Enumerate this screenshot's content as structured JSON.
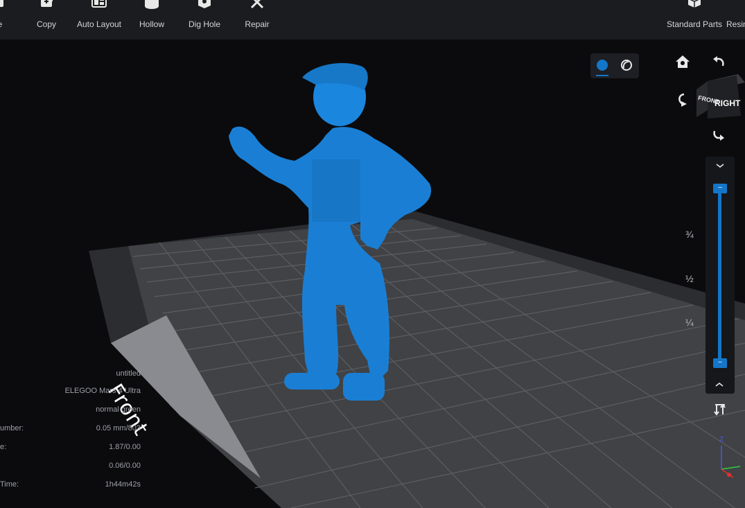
{
  "toolbar": {
    "items": [
      {
        "label": "e",
        "icon": "move-icon"
      },
      {
        "label": "Copy",
        "icon": "copy-icon"
      },
      {
        "label": "Auto Layout",
        "icon": "auto-layout-icon"
      },
      {
        "label": "Hollow",
        "icon": "hollow-icon"
      },
      {
        "label": "Dig Hole",
        "icon": "dig-hole-icon"
      },
      {
        "label": "Repair",
        "icon": "repair-icon"
      }
    ],
    "right_items": [
      {
        "label": "Standard Parts",
        "icon": "standard-parts-icon"
      },
      {
        "label": "Resin",
        "icon": "resin-icon"
      }
    ]
  },
  "viewport": {
    "plate_label": "Front",
    "view_cube": {
      "front": "FRONT",
      "right": "RIGHT"
    },
    "slider_marks": [
      "¾",
      "½",
      "¼"
    ],
    "slider": {
      "top_fraction": 1.0,
      "bottom_fraction": 0.0
    },
    "axes": {
      "z": "Z"
    },
    "colors": {
      "model": "#1a7fd4",
      "accent": "#1476c8",
      "plate": "#3b3c3f"
    }
  },
  "info": {
    "file_name": "untitled",
    "printer": "ELEGOO Mars 4 Ultra",
    "resin": "normal green",
    "rows": [
      {
        "label": "umber:",
        "value": "0.05 mm/803"
      },
      {
        "label": "e:",
        "value": "1.87/0.00"
      },
      {
        "label": "",
        "value": "0.06/0.00"
      },
      {
        "label": " Time:",
        "value": "1h44m42s"
      }
    ]
  }
}
